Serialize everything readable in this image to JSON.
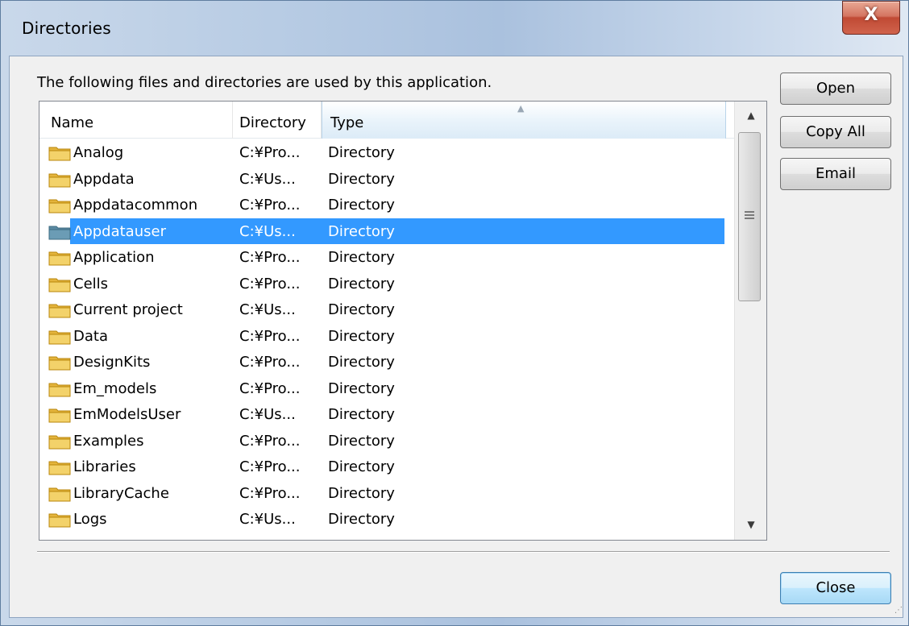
{
  "window": {
    "title": "Directories",
    "close_glyph": "X"
  },
  "description": "The following files and directories are used by this application.",
  "columns": [
    {
      "label": "Name"
    },
    {
      "label": "Directory"
    },
    {
      "label": "Type",
      "sorted": "ascending"
    }
  ],
  "rows": [
    {
      "name": "Analog",
      "directory": "C:¥Pro...",
      "type": "Directory",
      "icon": "folder-icon"
    },
    {
      "name": "Appdata",
      "directory": "C:¥Us...",
      "type": "Directory",
      "icon": "folder-icon"
    },
    {
      "name": "Appdatacommon",
      "directory": "C:¥Pro...",
      "type": "Directory",
      "icon": "folder-icon"
    },
    {
      "name": "Appdatauser",
      "directory": "C:¥Us...",
      "type": "Directory",
      "icon": "folder-icon",
      "selected": true
    },
    {
      "name": "Application",
      "directory": "C:¥Pro...",
      "type": "Directory",
      "icon": "folder-icon"
    },
    {
      "name": "Cells",
      "directory": "C:¥Pro...",
      "type": "Directory",
      "icon": "folder-icon"
    },
    {
      "name": "Current project",
      "directory": "C:¥Us...",
      "type": "Directory",
      "icon": "folder-icon"
    },
    {
      "name": "Data",
      "directory": "C:¥Pro...",
      "type": "Directory",
      "icon": "folder-icon"
    },
    {
      "name": "DesignKits",
      "directory": "C:¥Pro...",
      "type": "Directory",
      "icon": "folder-icon"
    },
    {
      "name": "Em_models",
      "directory": "C:¥Pro...",
      "type": "Directory",
      "icon": "folder-icon"
    },
    {
      "name": "EmModelsUser",
      "directory": "C:¥Us...",
      "type": "Directory",
      "icon": "folder-icon"
    },
    {
      "name": "Examples",
      "directory": "C:¥Pro...",
      "type": "Directory",
      "icon": "folder-icon"
    },
    {
      "name": "Libraries",
      "directory": "C:¥Pro...",
      "type": "Directory",
      "icon": "folder-icon"
    },
    {
      "name": "LibraryCache",
      "directory": "C:¥Pro...",
      "type": "Directory",
      "icon": "folder-icon"
    },
    {
      "name": "Logs",
      "directory": "C:¥Us...",
      "type": "Directory",
      "icon": "folder-icon"
    }
  ],
  "buttons": {
    "open": "Open",
    "copy_all": "Copy All",
    "email": "Email",
    "close": "Close"
  },
  "colors": {
    "selection": "#3399ff",
    "close_button": "#c7503a"
  }
}
